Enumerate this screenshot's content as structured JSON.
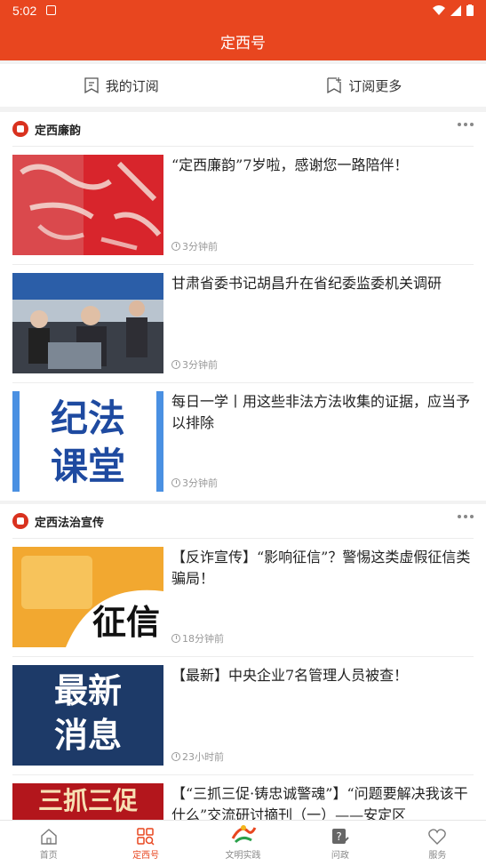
{
  "status": {
    "time": "5:02"
  },
  "header": {
    "title": "定西号"
  },
  "subbar": {
    "my_subs": "我的订阅",
    "more_subs": "订阅更多"
  },
  "sections": [
    {
      "name": "定西廉韵",
      "items": [
        {
          "title": "“定西廉韵”7岁啦，感谢您一路陪伴！",
          "time": "3分钟前"
        },
        {
          "title": "甘肃省委书记胡昌升在省纪委监委机关调研",
          "time": "3分钟前"
        },
        {
          "title": "每日一学丨用这些非法方法收集的证据，应当予以排除",
          "time": "3分钟前",
          "thumb_text": [
            "纪法",
            "课堂"
          ]
        }
      ]
    },
    {
      "name": "定西法治宣传",
      "items": [
        {
          "title": "【反诈宣传】“影响征信”？警惕这类虚假征信类骗局！",
          "time": "18分钟前",
          "thumb_text": [
            "征信"
          ]
        },
        {
          "title": "【最新】中央企业7名管理人员被查！",
          "time": "23小时前",
          "thumb_text": [
            "最新",
            "消息"
          ]
        },
        {
          "title": "【“三抓三促·铸忠诚警魂”】“问题要解决我该干什么”交流研讨摘刊（一）——安定区",
          "time": "",
          "thumb_text": [
            "三抓三促"
          ]
        }
      ]
    }
  ],
  "nav": {
    "home": "首页",
    "dingxihao": "定西号",
    "wenming": "文明实践",
    "wenzheng": "问政",
    "fuwu": "服务"
  },
  "colors": {
    "brand": "#e8461f"
  }
}
